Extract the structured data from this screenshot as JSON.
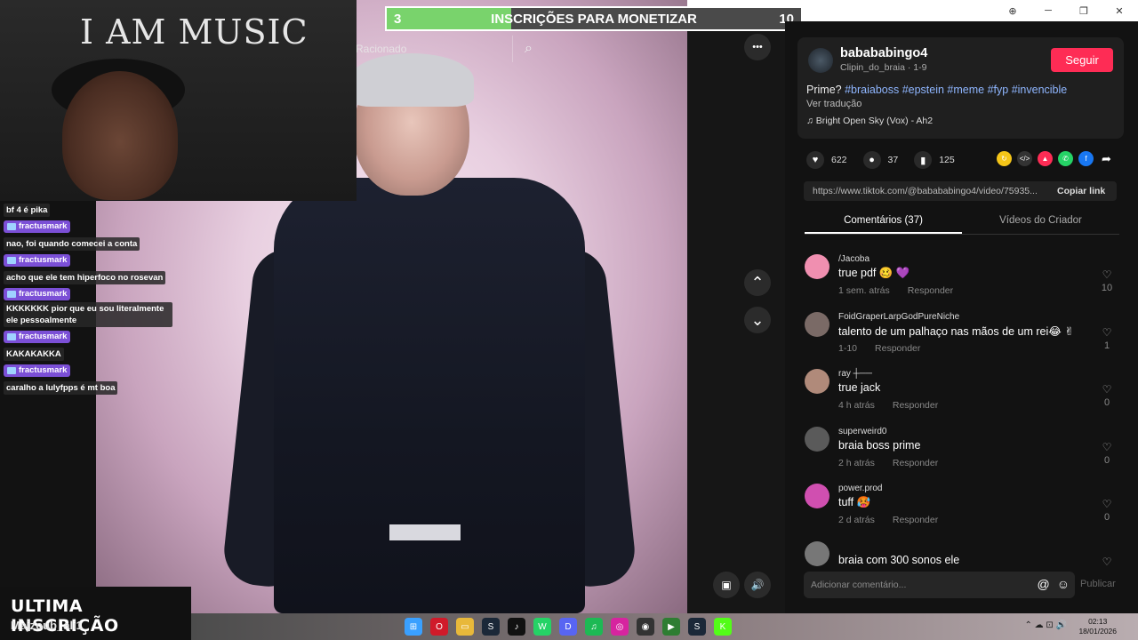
{
  "window": {
    "icons": [
      "zoom-icon",
      "minimize-icon",
      "maximize-icon",
      "close-icon"
    ],
    "glyphs": {
      "zoom": "⊕",
      "minimize": "─",
      "maximize": "❐",
      "close": "✕"
    }
  },
  "overlay": {
    "goal": {
      "start": "3",
      "title": "INSCRIÇÕES PARA MONETIZAR",
      "end": "10",
      "progress": 0.3
    },
    "webcam_sign": "I AM MUSIC",
    "last_sub": {
      "title": "ULTIMA INSCRIÇÃO",
      "name": "Majzoub_ali1"
    },
    "chat": [
      {
        "type": "msg",
        "text": "bf 4 é pika"
      },
      {
        "type": "user",
        "text": "fractusmark"
      },
      {
        "type": "msg",
        "text": "nao, foi quando comecei a conta"
      },
      {
        "type": "user",
        "text": "fractusmark"
      },
      {
        "type": "msg",
        "text": "acho que ele tem hiperfoco no rosevan"
      },
      {
        "type": "user",
        "text": "fractusmark"
      },
      {
        "type": "msg",
        "text": "KKKKKKK pior que eu sou literalmente ele pessoalmente"
      },
      {
        "type": "user",
        "text": "fractusmark"
      },
      {
        "type": "msg",
        "text": "KAKAKAKKA"
      },
      {
        "type": "user",
        "text": "fractusmark"
      },
      {
        "type": "msg",
        "text": "caralho a lulyfpps é mt boa"
      }
    ]
  },
  "video": {
    "search_text": "Racionado",
    "more_label": "•••",
    "up_label": "⌃",
    "down_label": "⌄",
    "report_label": "▣",
    "volume_label": "🔊"
  },
  "post": {
    "author": "babababingo4",
    "author_sub": "Clipin_do_braia · 1-9",
    "follow_label": "Seguir",
    "caption_prefix": "Prime? ",
    "hashtags": "#braiaboss #epstein #meme #fyp #invencible",
    "translate": "Ver tradução",
    "music": "♫  Bright Open Sky (Vox) - Ah2",
    "likes": "622",
    "comments_count": "37",
    "saves": "125",
    "url": "https://www.tiktok.com/@babababingo4/video/75935...",
    "copy_label": "Copiar link",
    "tabs": [
      "Comentários (37)",
      "Vídeos do Criador"
    ],
    "comment_placeholder": "Adicionar comentário...",
    "publish_label": "Publicar"
  },
  "comments": [
    {
      "user": "/Jacoba",
      "text": "true pdf 🥴 💜",
      "time": "1 sem. atrás",
      "reply": "Responder",
      "likes": "10",
      "color": "#f08fb0"
    },
    {
      "user": "FoidGraperLarpGodPureNiche",
      "text": "talento de um palhaço nas mãos de um rei😂 ✌",
      "time": "1-10",
      "reply": "Responder",
      "likes": "1",
      "color": "#7a6a66"
    },
    {
      "user": "ray ┼──",
      "text": "true jack",
      "time": "4 h atrás",
      "reply": "Responder",
      "likes": "0",
      "color": "#b08a7a"
    },
    {
      "user": "superweird0",
      "text": "braia boss prime",
      "time": "2 h atrás",
      "reply": "Responder",
      "likes": "0",
      "color": "#5a5a5a"
    },
    {
      "user": "power.prod",
      "text": "tuff 🥵",
      "time": "2 d atrás",
      "reply": "Responder",
      "likes": "0",
      "color": "#d04fb0"
    },
    {
      "user": "",
      "text": "braia com 300 sonos ele",
      "time": "",
      "reply": "",
      "likes": "",
      "color": "#777777"
    }
  ],
  "taskbar": {
    "apps": [
      {
        "name": "windows-start-icon",
        "glyph": "⊞",
        "color": "#3aa0ff"
      },
      {
        "name": "opera-icon",
        "glyph": "O",
        "color": "#d01a2a"
      },
      {
        "name": "folder-icon",
        "glyph": "▭",
        "color": "#e8b83a"
      },
      {
        "name": "steam-icon",
        "glyph": "S",
        "color": "#1b2838"
      },
      {
        "name": "tiktok-icon",
        "glyph": "♪",
        "color": "#111111"
      },
      {
        "name": "whatsapp-icon",
        "glyph": "W",
        "color": "#25d366"
      },
      {
        "name": "discord-icon",
        "glyph": "D",
        "color": "#5865f2"
      },
      {
        "name": "spotify-icon",
        "glyph": "♫",
        "color": "#1db954"
      },
      {
        "name": "instagram-icon",
        "glyph": "◎",
        "color": "#d6249f"
      },
      {
        "name": "obs-icon",
        "glyph": "◉",
        "color": "#333333"
      },
      {
        "name": "terminal-icon",
        "glyph": "▶",
        "color": "#2e7d32"
      },
      {
        "name": "steam2-icon",
        "glyph": "S",
        "color": "#1b2838"
      },
      {
        "name": "kick-icon",
        "glyph": "K",
        "color": "#53fc18"
      }
    ],
    "tray": "⌃  ☁  ⊡  🔊",
    "time": "02:13",
    "date": "18/01/2026"
  }
}
